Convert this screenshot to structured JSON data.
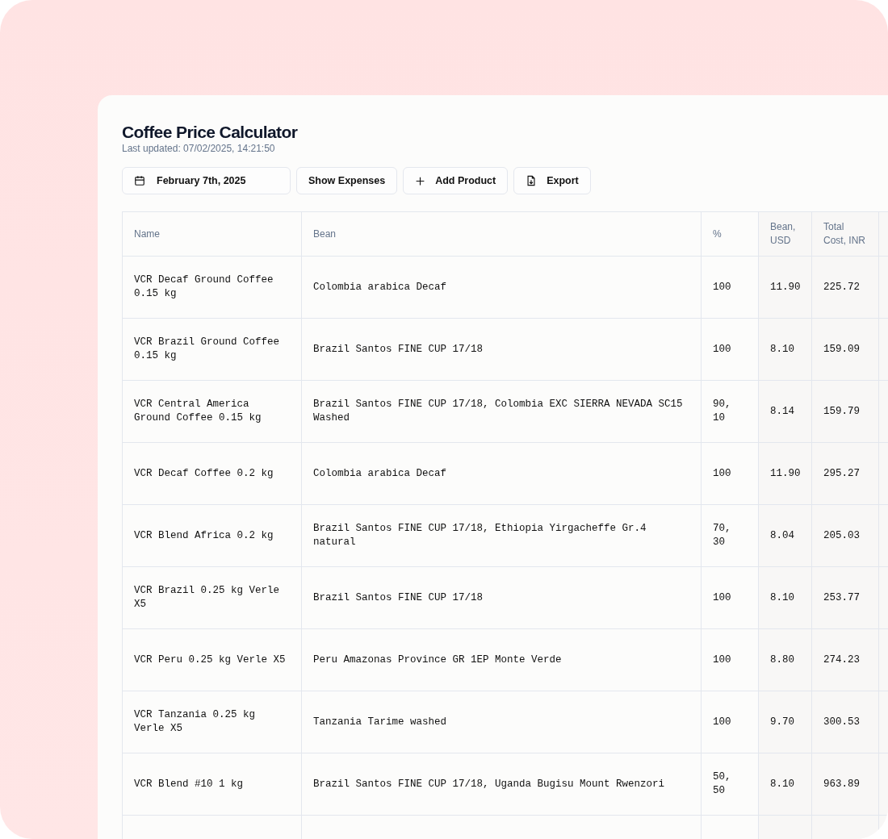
{
  "title": "Coffee Price Calculator",
  "last_updated": "Last updated: 07/02/2025, 14:21:50",
  "toolbar": [
    {
      "kind": "date",
      "label": "February 7th, 2025"
    },
    {
      "kind": "plain",
      "label": "Show Expenses"
    },
    {
      "kind": "add",
      "label": "Add Product"
    },
    {
      "kind": "export",
      "label": "Export"
    }
  ],
  "table": {
    "columns": [
      "Name",
      "Bean",
      "%",
      "Bean, USD",
      "Total Cost, INR"
    ],
    "rows": [
      [
        "VCR Decaf Ground Coffee 0.15 kg",
        "Colombia arabica Decaf",
        "100",
        "11.90",
        "225.72"
      ],
      [
        "VCR Brazil Ground Coffee 0.15 kg",
        "Brazil Santos FINE CUP 17/18",
        "100",
        "8.10",
        "159.09"
      ],
      [
        "VCR Central America Ground Coffee 0.15 kg",
        "Brazil Santos FINE CUP 17/18, Colombia EXC SIERRA NEVADA SC15 Washed",
        "90, 10",
        "8.14",
        "159.79"
      ],
      [
        "VCR Decaf Coffee 0.2 kg",
        "Colombia arabica Decaf",
        "100",
        "11.90",
        "295.27"
      ],
      [
        "VCR Blend Africa 0.2 kg",
        "Brazil Santos FINE CUP 17/18, Ethiopia Yirgacheffe Gr.4 natural",
        "70, 30",
        "8.04",
        "205.03"
      ],
      [
        "VCR Brazil 0.25 kg Verle X5",
        "Brazil Santos FINE CUP 17/18",
        "100",
        "8.10",
        "253.77"
      ],
      [
        "VCR Peru 0.25 kg Verle X5",
        "Peru Amazonas Province GR 1EP Monte Verde",
        "100",
        "8.80",
        "274.23"
      ],
      [
        "VCR Tanzania 0.25 kg Verle X5",
        "Tanzania Tarime washed",
        "100",
        "9.70",
        "300.53"
      ],
      [
        "VCR Blend #10 1 kg",
        "Brazil Santos FINE CUP 17/18, Uganda Bugisu Mount Rwenzori",
        "50, 50",
        "8.10",
        "963.89"
      ]
    ]
  }
}
